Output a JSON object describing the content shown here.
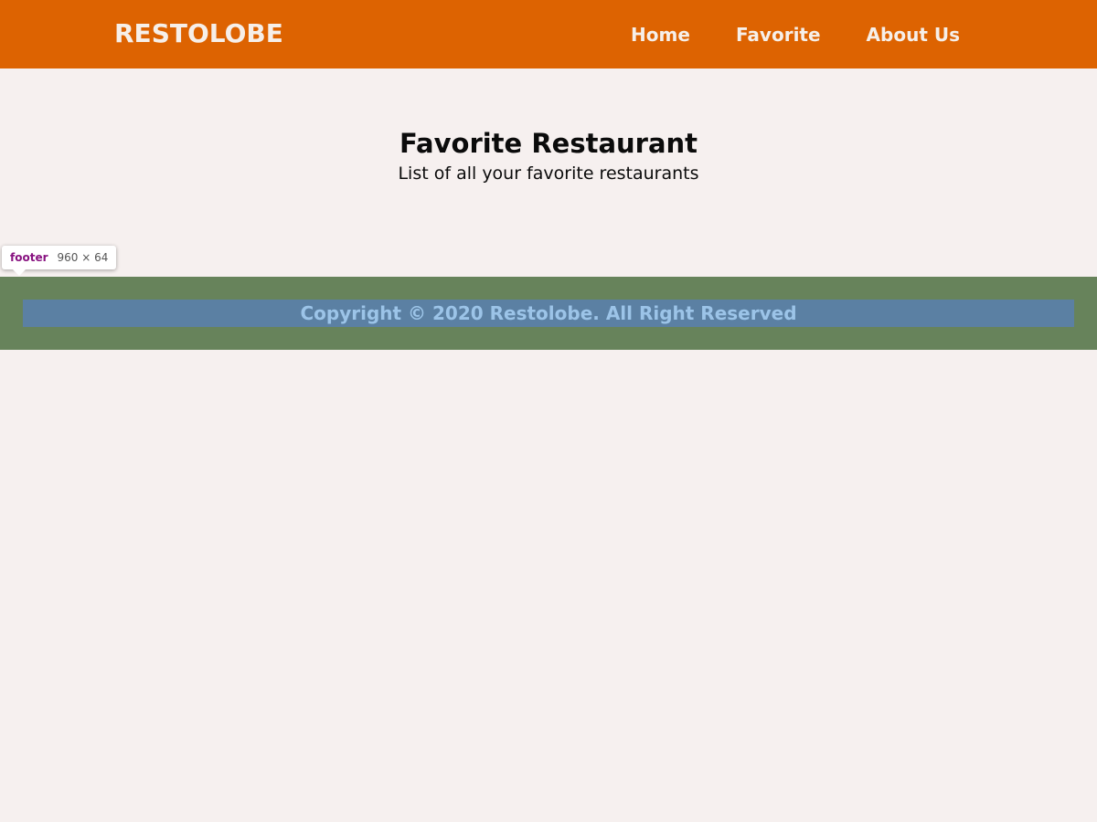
{
  "header": {
    "brand": "RESTOLOBE",
    "nav": [
      {
        "label": "Home"
      },
      {
        "label": "Favorite"
      },
      {
        "label": "About Us"
      }
    ],
    "background_color": "#dd6301"
  },
  "main": {
    "title": "Favorite Restaurant",
    "subtitle": "List of all your favorite restaurants"
  },
  "inspector": {
    "tag": "footer",
    "dimensions": "960 × 64"
  },
  "footer": {
    "copyright": "Copyright © 2020 Restolobe. All Right Reserved",
    "highlight_margin_color": "#67835b",
    "highlight_content_color": "#5b80a3"
  }
}
